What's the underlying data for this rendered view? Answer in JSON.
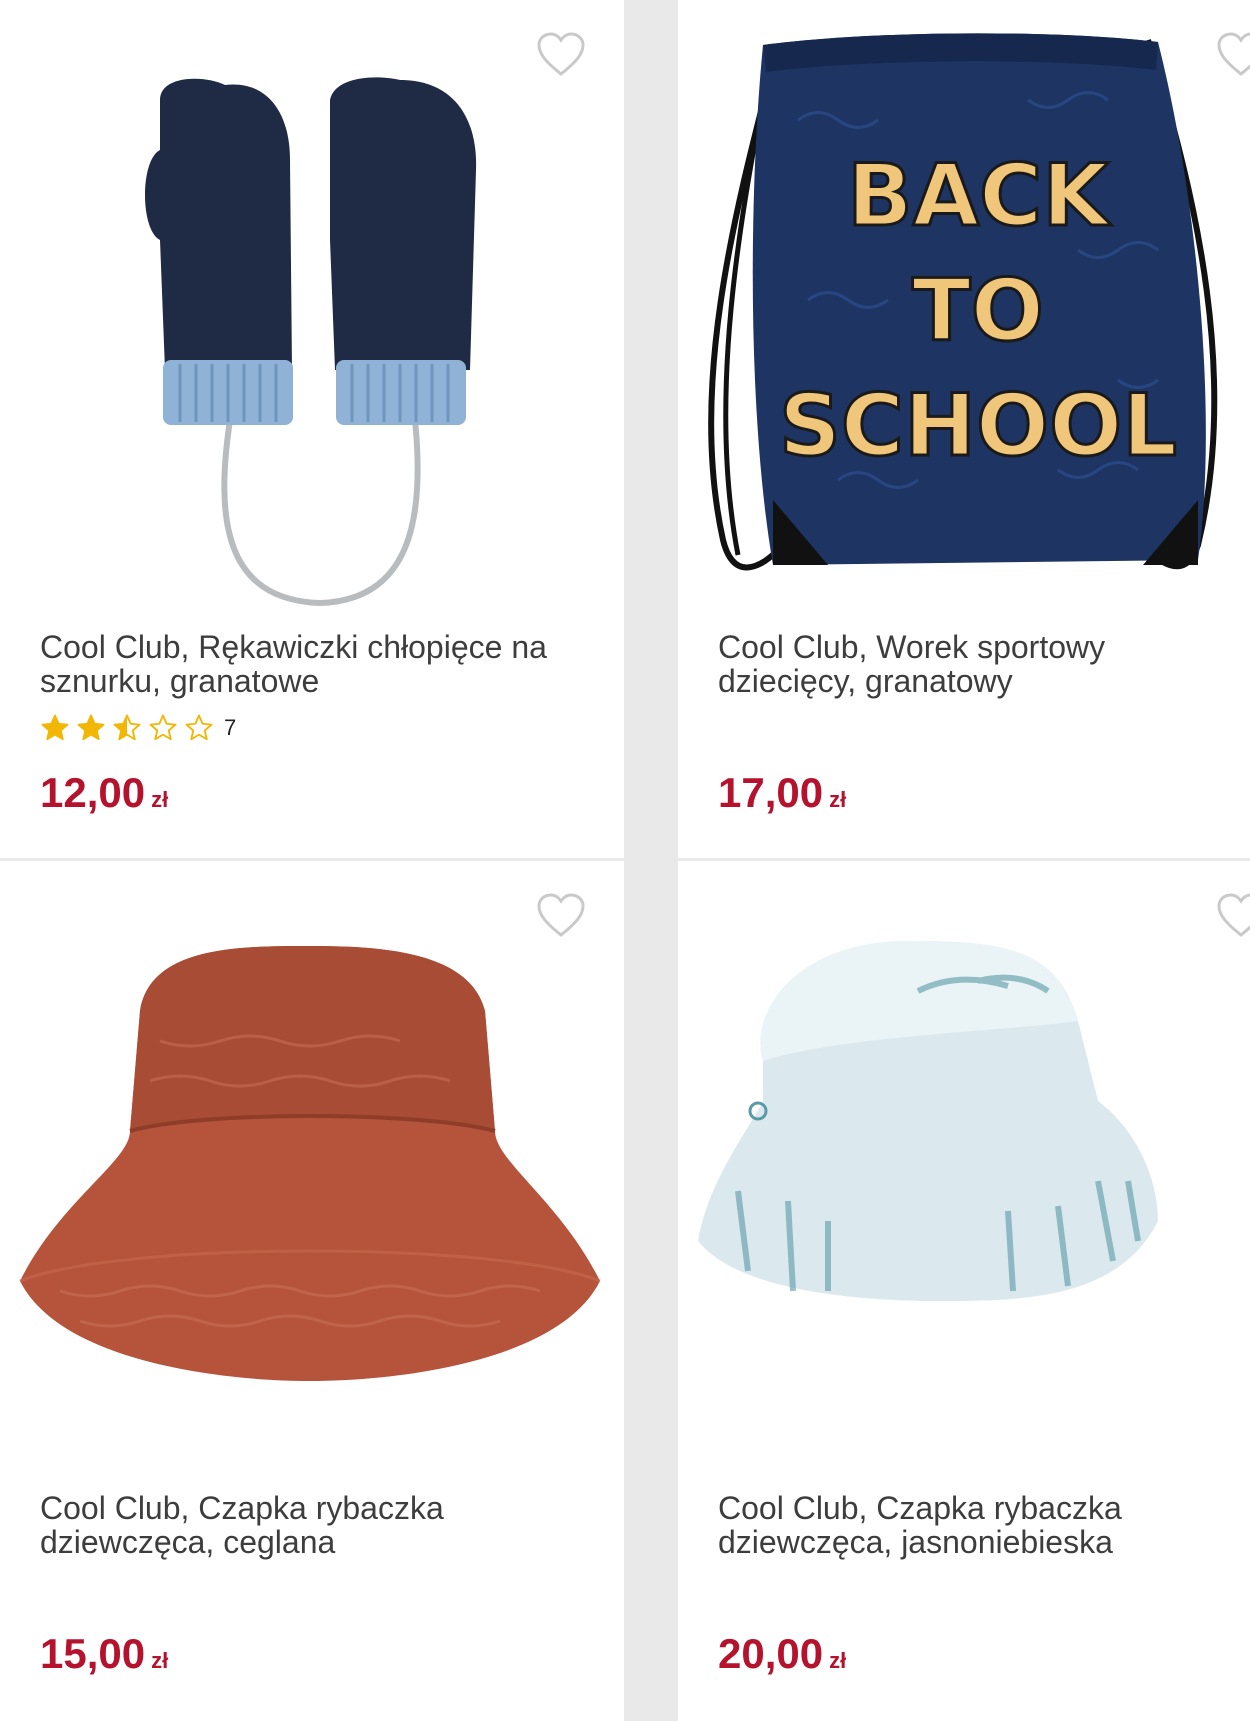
{
  "products": [
    {
      "title": "Cool Club, Rękawiczki chłopięce na sznurku, granatowe",
      "rating_value": 2.5,
      "rating_max": 5,
      "rating_count": "7",
      "price": "12,00",
      "currency": "zł",
      "image_icon": "mittens-image"
    },
    {
      "title": "Cool Club, Worek sportowy dziecięcy, granatowy",
      "price": "17,00",
      "currency": "zł",
      "image_icon": "drawstring-bag-image",
      "print_lines": [
        "BACK",
        "TO",
        "SCHOOL"
      ]
    },
    {
      "title": "Cool Club, Czapka rybaczka dziewczęca, ceglana",
      "price": "15,00",
      "currency": "zł",
      "image_icon": "bucket-hat-brick-image"
    },
    {
      "title": "Cool Club, Czapka rybaczka dziewczęca, jasnoniebieska",
      "price": "20,00",
      "currency": "zł",
      "image_icon": "bucket-hat-lightblue-image"
    }
  ],
  "colors": {
    "price": "#b5122d",
    "star": "#f2b705",
    "text": "#3d3d3d"
  }
}
